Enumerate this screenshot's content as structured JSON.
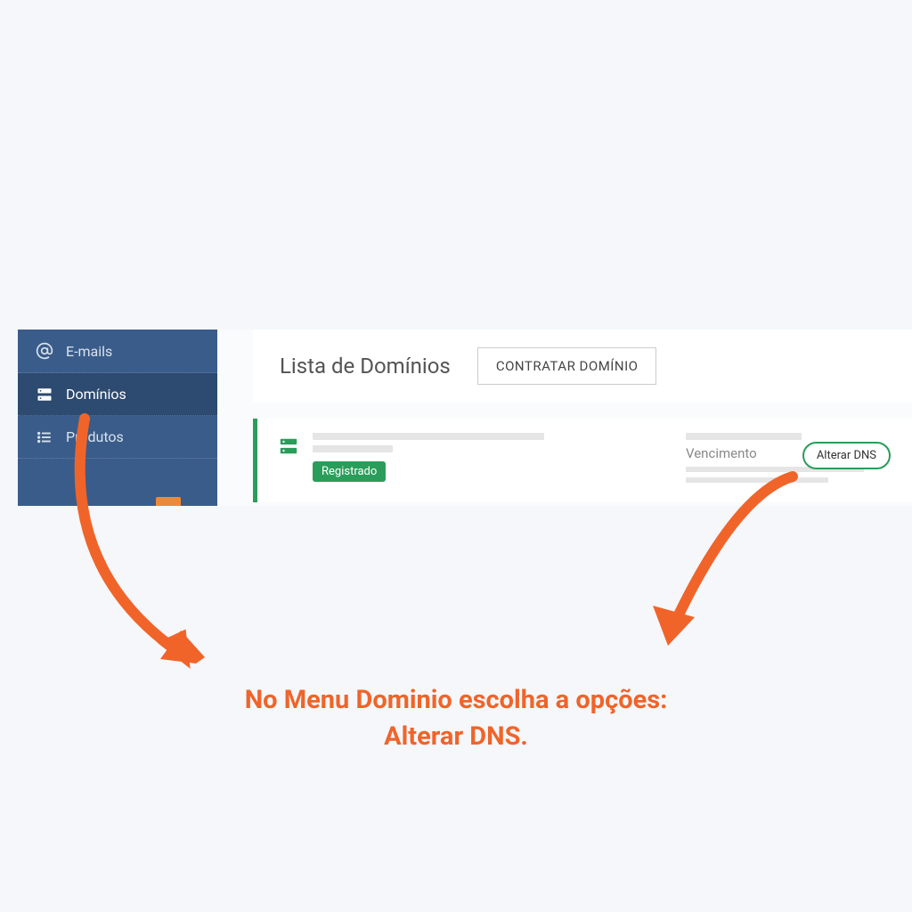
{
  "sidebar": {
    "items": [
      {
        "label": "E-mails",
        "icon": "at"
      },
      {
        "label": "Domínios",
        "icon": "server"
      },
      {
        "label": "Produtos",
        "icon": "list"
      }
    ]
  },
  "header": {
    "title": "Lista de Domínios",
    "contract_button": "CONTRATAR DOMÍNIO"
  },
  "domain_card": {
    "status": "Registrado",
    "expiry_label": "Vencimento",
    "alter_dns": "Alterar DNS"
  },
  "annotation": {
    "line1": "No Menu Dominio escolha a opções:",
    "line2": "Alterar DNS."
  },
  "colors": {
    "accent_orange": "#f0642a",
    "sidebar_blue": "#3a5c8a",
    "green": "#2a9d5a"
  }
}
